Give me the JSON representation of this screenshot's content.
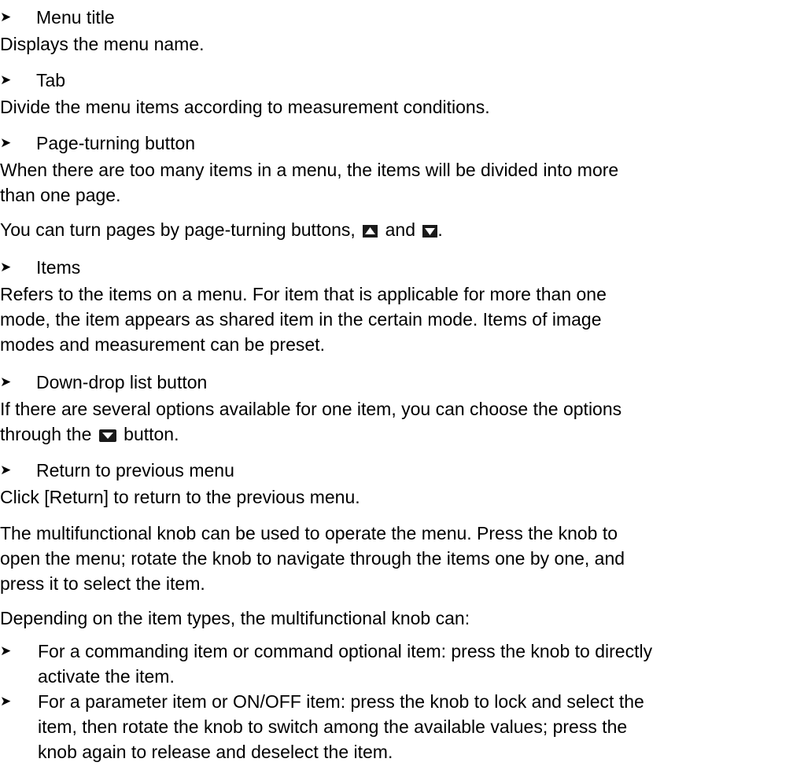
{
  "bullet_glyph": "➤",
  "sections": [
    {
      "head": "Menu title",
      "body": "Displays the menu name."
    },
    {
      "head": "Tab",
      "body": "Divide the menu items according to measurement conditions."
    },
    {
      "head": "Page-turning button",
      "body_line1": "When there are too many items in a menu, the items will be divided into more",
      "body_line2": "than one page.",
      "extra_before": "You can turn pages by page-turning buttons,",
      "extra_and": "and",
      "extra_after": "."
    },
    {
      "head": "Items",
      "body_line1": "Refers to the items on a menu. For item that is applicable for more than one",
      "body_line2": "mode, the item appears as shared item in the certain mode. Items of image",
      "body_line3": "modes and measurement can be preset."
    },
    {
      "head": "Down-drop list button",
      "body_line1": "If there are several options available for one item, you can choose the options",
      "body_line2_before": "through the",
      "body_line2_after": "button."
    },
    {
      "head": "Return to previous menu",
      "body": "Click [Return] to return to the previous menu."
    }
  ],
  "knob_paragraph": {
    "line1": "The multifunctional knob can be used to operate the menu. Press the knob to",
    "line2": "open the menu; rotate the knob to navigate through the items one by one, and",
    "line3": "press it to select the item."
  },
  "depending": "Depending on the item types, the multifunctional knob can:",
  "list": [
    {
      "line1": "For a commanding item or command optional item: press the knob to directly",
      "line2": "activate the item."
    },
    {
      "line1": "For a parameter item or ON/OFF item: press the knob to lock and select the",
      "line2": "item, then rotate the knob to switch among the available values; press the",
      "line3": "knob again to release and deselect the item."
    }
  ],
  "icons": {
    "page_up": "page-up-button-icon",
    "page_down": "page-down-button-icon",
    "dropdown": "dropdown-button-icon"
  },
  "colors": {
    "text": "#000000",
    "icon_bg": "#1a1a1a",
    "icon_fg": "#ffffff"
  }
}
